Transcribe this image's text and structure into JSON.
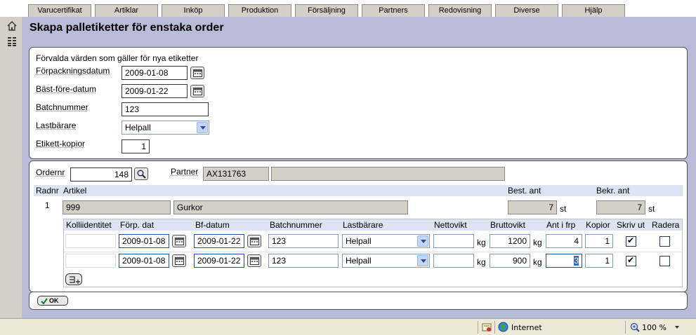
{
  "tabs": [
    "Varucertifikat",
    "Artiklar",
    "Inköp",
    "Produktion",
    "Försäljning",
    "Partners",
    "Redovisning",
    "Diverse",
    "Hjälp"
  ],
  "left_icons": [
    "home-icon",
    "list-icon"
  ],
  "page_title": "Skapa palletiketter för enstaka order",
  "defaults": {
    "heading": "Förvalda värden som gäller för nya etiketter",
    "packing_date_label": "Förpackningsdatum",
    "packing_date": "2009-01-08",
    "best_before_label": "Bäst-före-datum",
    "best_before": "2009-01-22",
    "batch_label": "Batchnummer",
    "batch": "123",
    "carrier_label": "Lastbärare",
    "carrier": "Helpall",
    "copies_label": "Etikett-kopior",
    "copies": "1"
  },
  "order": {
    "ordernr_label": "Ordernr",
    "ordernr": "148",
    "partner_label": "Partner",
    "partner_code": "AX131763",
    "partner_name": ""
  },
  "article_table": {
    "headers": {
      "radnr": "Radnr",
      "artikel": "Artikel",
      "best_ant": "Best. ant",
      "bekr_ant": "Bekr. ant"
    },
    "row": {
      "radnr": "1",
      "code": "999",
      "name": "Gurkor",
      "best_ant": "7",
      "best_unit": "st",
      "bekr_ant": "7",
      "bekr_unit": "st"
    }
  },
  "pallet_table": {
    "headers": [
      "Kolliidentitet",
      "Förp. dat",
      "Bf-datum",
      "Batchnummer",
      "Lastbärare",
      "Nettovikt",
      "Bruttovikt",
      "Ant i frp",
      "Kopior",
      "Skriv ut",
      "Radera"
    ],
    "rows": [
      {
        "kolli": "",
        "forp_dat": "2009-01-08",
        "bf_datum": "2009-01-22",
        "batch": "123",
        "carrier": "Helpall",
        "netto": "",
        "netto_unit": "kg",
        "brutto": "1200",
        "brutto_unit": "kg",
        "ant": "4",
        "kopior": "1",
        "skriv_ut": true,
        "radera": false
      },
      {
        "kolli": "",
        "forp_dat": "2009-01-08",
        "bf_datum": "2009-01-22",
        "batch": "123",
        "carrier": "Helpall",
        "netto": "",
        "netto_unit": "kg",
        "brutto": "900",
        "brutto_unit": "kg",
        "ant": "3",
        "kopior": "1",
        "skriv_ut": true,
        "radera": false
      }
    ]
  },
  "ok_button": "OK",
  "statusbar": {
    "zone": "Internet",
    "zoom": "100 %"
  }
}
